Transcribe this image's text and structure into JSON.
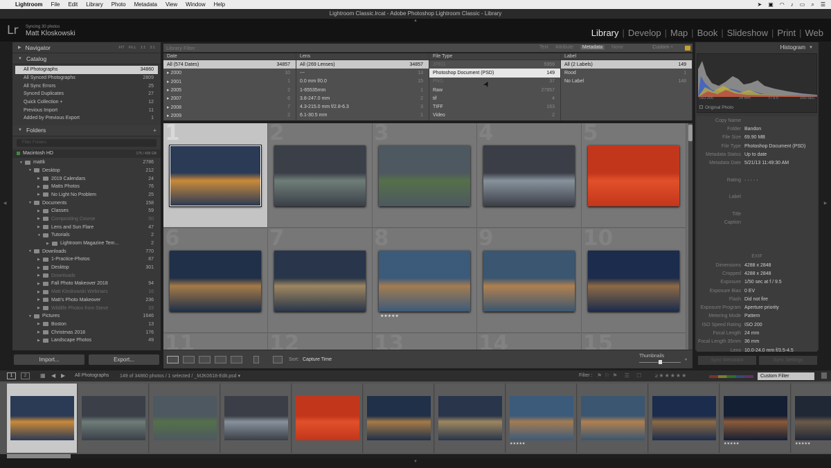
{
  "mac_menu": {
    "app": "Lightroom",
    "items": [
      "File",
      "Edit",
      "Library",
      "Photo",
      "Metadata",
      "View",
      "Window",
      "Help"
    ]
  },
  "window_title": "Lightroom Classic.lrcat - Adobe Photoshop Lightroom Classic - Library",
  "identity": {
    "logo": "Lr",
    "sync_status": "Syncing 30 photos",
    "user": "Matt Kloskowski"
  },
  "modules": [
    "Library",
    "Develop",
    "Map",
    "Book",
    "Slideshow",
    "Print",
    "Web"
  ],
  "active_module": "Library",
  "left": {
    "navigator": {
      "title": "Navigator",
      "zoom": [
        "FIT",
        "FILL",
        "1:1",
        "3:1"
      ]
    },
    "catalog": {
      "title": "Catalog",
      "items": [
        {
          "label": "All Photographs",
          "count": "34860",
          "selected": true
        },
        {
          "label": "All Synced Photographs",
          "count": "2809"
        },
        {
          "label": "All Sync Errors",
          "count": "25"
        },
        {
          "label": "Synced Duplicates",
          "count": "27"
        },
        {
          "label": "Quick Collection  +",
          "count": "12"
        },
        {
          "label": "Previous Import",
          "count": "11"
        },
        {
          "label": "Added by Previous Export",
          "count": "1"
        }
      ]
    },
    "folders": {
      "title": "Folders",
      "filter_placeholder": "Filter Folders",
      "volume": "Macintosh HD",
      "volume_info": "175 / 499 GB",
      "items": [
        {
          "label": "mattk",
          "count": "2786",
          "depth": 0,
          "open": true
        },
        {
          "label": "Desktop",
          "count": "212",
          "depth": 1,
          "open": true
        },
        {
          "label": "2019 Calendars",
          "count": "24",
          "depth": 2
        },
        {
          "label": "Matts Photos",
          "count": "76",
          "depth": 2
        },
        {
          "label": "No Light No Problem",
          "count": "25",
          "depth": 2
        },
        {
          "label": "Documents",
          "count": "158",
          "depth": 1,
          "open": true
        },
        {
          "label": "Classes",
          "count": "59",
          "depth": 2
        },
        {
          "label": "Compositing Course",
          "count": "50",
          "depth": 2,
          "dim": true
        },
        {
          "label": "Lens and Sun Flare",
          "count": "47",
          "depth": 2
        },
        {
          "label": "Tutorials",
          "count": "2",
          "depth": 2,
          "open": true
        },
        {
          "label": "Lightroom Magazine Tem...",
          "count": "2",
          "depth": 3
        },
        {
          "label": "Downloads",
          "count": "770",
          "depth": 1,
          "open": true
        },
        {
          "label": "1-Practice-Photos",
          "count": "87",
          "depth": 2
        },
        {
          "label": "Desktop",
          "count": "301",
          "depth": 2
        },
        {
          "label": "Downloads",
          "count": "",
          "depth": 2,
          "dim": true
        },
        {
          "label": "Fall Photo Makeover 2018",
          "count": "94",
          "depth": 2
        },
        {
          "label": "Matt Kloskowski Webinars",
          "count": "16",
          "depth": 2,
          "dim": true
        },
        {
          "label": "Matt's Photo Makeover",
          "count": "236",
          "depth": 2
        },
        {
          "label": "Wildlife Photos from Steve",
          "count": "33",
          "depth": 2,
          "dim": true
        },
        {
          "label": "Pictures",
          "count": "1646",
          "depth": 1,
          "open": true
        },
        {
          "label": "Boston",
          "count": "13",
          "depth": 2
        },
        {
          "label": "Christmas 2018",
          "count": "176",
          "depth": 2
        },
        {
          "label": "Landscape Photos",
          "count": "49",
          "depth": 2
        }
      ]
    },
    "import_label": "Import...",
    "export_label": "Export..."
  },
  "filter": {
    "label": "Library Filter :",
    "options": [
      "Text",
      "Attribute",
      "Metadata",
      "None"
    ],
    "active": "Metadata",
    "preset": "Custom ÷",
    "columns": [
      {
        "title": "Date",
        "rows": [
          [
            "All (574 Dates)",
            "34857"
          ],
          [
            "▸ 2000",
            "10"
          ],
          [
            "▸ 2001",
            "1"
          ],
          [
            "▸ 2005",
            "2"
          ],
          [
            "▸ 2007",
            "6"
          ],
          [
            "▸ 2008",
            "7"
          ],
          [
            "▸ 2009",
            "2"
          ]
        ]
      },
      {
        "title": "Lens",
        "rows": [
          [
            "All (269 Lenses)",
            "34857"
          ],
          [
            "---",
            "13"
          ],
          [
            "0.0 mm f/0.0",
            "15"
          ],
          [
            "1-65535mm",
            "1"
          ],
          [
            "3.8-247.0 mm",
            "2"
          ],
          [
            "4.3-215.0 mm f/2.8-6.3",
            "3"
          ],
          [
            "6.1-30.5 mm",
            "1"
          ]
        ]
      },
      {
        "title": "File Type",
        "rows": [
          [
            "JPEG",
            "5959"
          ],
          [
            "Photoshop Document (PSD)",
            "149"
          ],
          [
            "PNG",
            "37"
          ],
          [
            "Raw",
            "27857"
          ],
          [
            "tif",
            "4"
          ],
          [
            "TIFF",
            "163"
          ],
          [
            "Video",
            "2"
          ]
        ]
      },
      {
        "title": "Label",
        "rows": [
          [
            "All (2 Labels)",
            "149"
          ],
          [
            "Rood",
            "1"
          ],
          [
            "No Label",
            "148"
          ]
        ]
      }
    ]
  },
  "grid": {
    "cells": [
      {
        "n": "1",
        "c": "#2b3a55",
        "c2": "#c98a3a",
        "selected": true
      },
      {
        "n": "2",
        "c": "#3a3f48",
        "c2": "#6f7d78"
      },
      {
        "n": "3",
        "c": "#4d5860",
        "c2": "#55704a"
      },
      {
        "n": "4",
        "c": "#3b3e46",
        "c2": "#87929c"
      },
      {
        "n": "5",
        "c": "#c2361c",
        "c2": "#e2502a"
      },
      {
        "n": "6",
        "c": "#1f3048",
        "c2": "#a47a48"
      },
      {
        "n": "7",
        "c": "#28354a",
        "c2": "#9d8660"
      },
      {
        "n": "8",
        "c": "#3c5a7a",
        "c2": "#a27c52",
        "stars": "★★★★★"
      },
      {
        "n": "9",
        "c": "#3a5670",
        "c2": "#b08050"
      },
      {
        "n": "10",
        "c": "#1b2c4c",
        "c2": "#8d6a46"
      },
      {
        "n": "11",
        "c": "#555",
        "c2": "#555"
      },
      {
        "n": "12",
        "c": "#555",
        "c2": "#555"
      },
      {
        "n": "13",
        "c": "#555",
        "c2": "#555"
      },
      {
        "n": "14",
        "c": "#555",
        "c2": "#555"
      },
      {
        "n": "15",
        "c": "#555",
        "c2": "#555"
      }
    ]
  },
  "toolbar": {
    "sort_label": "Sort:",
    "sort_value": "Capture Time",
    "thumb_label": "Thumbnails"
  },
  "right": {
    "histogram_title": "Histogram",
    "iso": "ISO 200",
    "focal": "24 mm",
    "aperture": "f / 9.5",
    "shutter": "1/50 SEC",
    "original_photo": "Original Photo",
    "meta": [
      [
        "Copy Name",
        ""
      ],
      [
        "Folder",
        "Bandon"
      ],
      [
        "File Size",
        "69.90 MB"
      ],
      [
        "File Type",
        "Photoshop Document (PSD)"
      ],
      [
        "Metadata Status",
        "Up to date"
      ],
      [
        "Metadata Date",
        "5/21/13 11:49:30 AM"
      ],
      [
        "",
        ""
      ],
      [
        "Rating",
        "·  ·  ·  ·  ·"
      ],
      [
        "",
        ""
      ],
      [
        "Label",
        ""
      ],
      [
        "",
        ""
      ],
      [
        "Title",
        ""
      ],
      [
        "Caption",
        ""
      ],
      [
        "",
        ""
      ],
      [
        "",
        ""
      ],
      [
        "",
        ""
      ],
      [
        "EXIF",
        ""
      ],
      [
        "Dimensions",
        "4288 x 2848"
      ],
      [
        "Cropped",
        "4288 x 2848"
      ],
      [
        "Exposure",
        "1/50 sec at f / 9.5"
      ],
      [
        "Exposure Bias",
        "0 EV"
      ],
      [
        "Flash",
        "Did not fire"
      ],
      [
        "Exposure Program",
        "Aperture priority"
      ],
      [
        "Metering Mode",
        "Pattern"
      ],
      [
        "ISO Speed Rating",
        "ISO 200"
      ],
      [
        "Focal Length",
        "24 mm"
      ],
      [
        "Focal Length 35mm",
        "36 mm"
      ],
      [
        "Lens",
        "10.0-24.0 mm f/3.5-4.5"
      ],
      [
        "Date Time Original",
        "5/26/10 10:22:20 PM"
      ],
      [
        "Date Time Digitized",
        "5/26/10 10:22:20 PM"
      ]
    ],
    "sync_metadata": "Sync Metadata",
    "sync_settings": "Sync Settings"
  },
  "filmstrip": {
    "pages": [
      "1",
      "2"
    ],
    "source": "All Photographs",
    "info": "149 of 34860 photos / 1 selected / _MJK0618-Edit.psd ▾",
    "filter_label": "Filter :",
    "filter_value": "Custom Filter",
    "thumbs": [
      {
        "c": "#2b3a55",
        "c2": "#c98a3a",
        "selected": true
      },
      {
        "c": "#3a3f48",
        "c2": "#6f7d78"
      },
      {
        "c": "#4d5860",
        "c2": "#55704a"
      },
      {
        "c": "#3b3e46",
        "c2": "#87929c"
      },
      {
        "c": "#c2361c",
        "c2": "#e2502a"
      },
      {
        "c": "#1f3048",
        "c2": "#a47a48"
      },
      {
        "c": "#28354a",
        "c2": "#9d8660"
      },
      {
        "c": "#3c5a7a",
        "c2": "#a27c52",
        "stars": "★★★★★"
      },
      {
        "c": "#3a5670",
        "c2": "#b08050"
      },
      {
        "c": "#1b2c4c",
        "c2": "#8d6a46"
      },
      {
        "c": "#151f33",
        "c2": "#8a5a3a",
        "stars": "★★★★★"
      },
      {
        "c": "#202836",
        "c2": "#6b5a4a",
        "stars": "★★★★★"
      }
    ]
  }
}
